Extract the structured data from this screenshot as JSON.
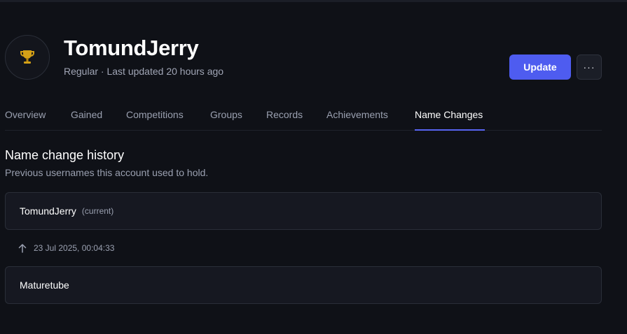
{
  "player": {
    "name": "TomundJerry",
    "subtitle": "Regular · Last updated 20 hours ago",
    "avatar_icon": "trophy-icon"
  },
  "actions": {
    "update_label": "Update",
    "more_label": "···"
  },
  "tabs": [
    {
      "label": "Overview"
    },
    {
      "label": "Gained"
    },
    {
      "label": "Competitions"
    },
    {
      "label": "Groups"
    },
    {
      "label": "Records"
    },
    {
      "label": "Achievements"
    },
    {
      "label": "Name Changes",
      "active": true
    }
  ],
  "section": {
    "title": "Name change history",
    "subtitle": "Previous usernames this account used to hold."
  },
  "history": {
    "current": {
      "name": "TomundJerry",
      "tag": "(current)"
    },
    "change": {
      "icon": "arrow-up-icon",
      "date": "23 Jul 2025, 00:04:33"
    },
    "previous": {
      "name": "Maturetube"
    }
  },
  "colors": {
    "accent": "#4e5cf0",
    "background": "#0f1117",
    "card": "#161821"
  }
}
